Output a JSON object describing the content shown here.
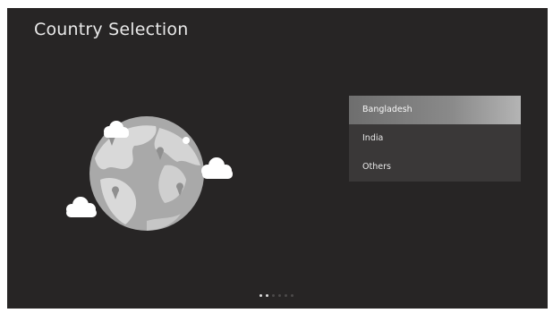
{
  "header": {
    "title": "Country Selection"
  },
  "country_list": {
    "items": [
      {
        "label": "Bangladesh",
        "selected": true
      },
      {
        "label": "India",
        "selected": false
      },
      {
        "label": "Others",
        "selected": false
      }
    ]
  },
  "pager": {
    "total_pages": 6,
    "current_page": 2
  },
  "illustration": {
    "icon": "globe-icon"
  },
  "colors": {
    "background": "#272525",
    "list_background": "#3a3838",
    "selected_item": "#8a8a8a",
    "text": "#e8e8e8"
  }
}
